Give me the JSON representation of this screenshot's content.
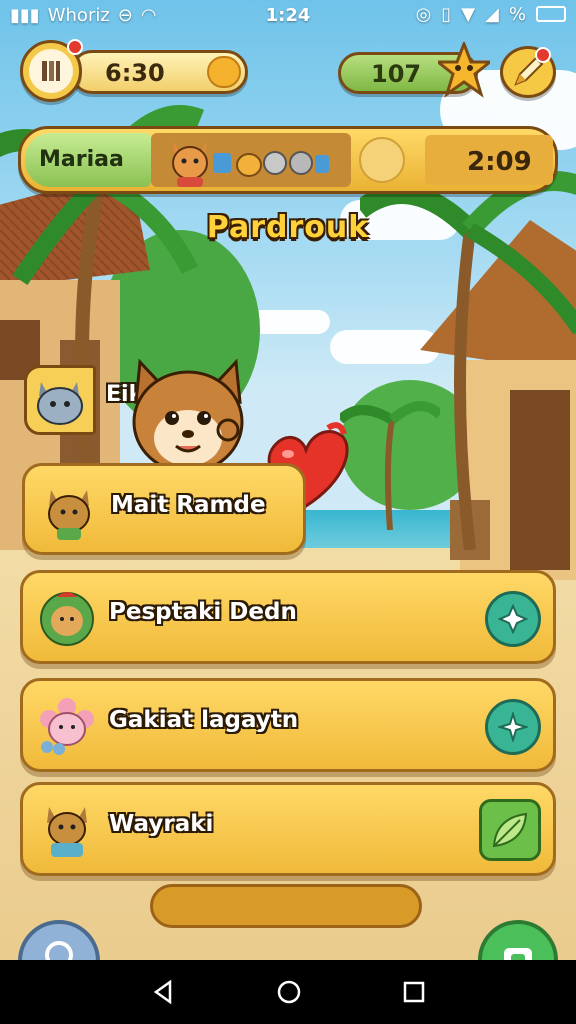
{
  "status_bar": {
    "carrier": "Whoriz",
    "time": "1:24",
    "icons": [
      "signal-icon",
      "do-not-disturb-icon",
      "wifi-icon",
      "alarm-icon",
      "vibrate-icon",
      "wifi-full-icon",
      "cell-signal-icon",
      "battery-icon"
    ],
    "battery_text": "%"
  },
  "hud": {
    "timer": "6:30",
    "coins": "107"
  },
  "player": {
    "name": "Mariaa",
    "time": "2:09"
  },
  "game_title": "Pardrouk",
  "cat_label": "Eikelinua",
  "menu": [
    {
      "label": "Mait Ramde",
      "icon": "cat-character-icon"
    },
    {
      "label": "Pesptaki Dedn",
      "icon": "plant-character-icon"
    },
    {
      "label": "Gakiat lagaytn",
      "icon": "pink-flower-character-icon"
    },
    {
      "label": "Wayraki",
      "icon": "cat-character-icon"
    }
  ],
  "colors": {
    "accent_gold": "#f0ba3a",
    "accent_green": "#39b596",
    "outline_brown": "#7a4a15"
  },
  "progress_fraction": 0.0
}
